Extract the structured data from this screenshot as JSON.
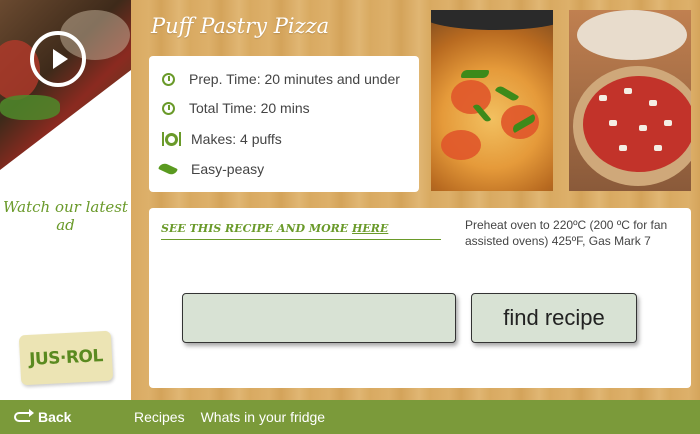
{
  "left_panel": {
    "watch_text": "Watch our latest ad",
    "logo_text": "JUS·ROL"
  },
  "recipe": {
    "title": "Puff Pastry Pizza",
    "info": [
      {
        "icon": "clock-icon",
        "label": "Prep. Time: 20 minutes and under"
      },
      {
        "icon": "timer-icon",
        "label": "Total Time: 20 mins"
      },
      {
        "icon": "plate-icon",
        "label": "Makes: 4 puffs"
      },
      {
        "icon": "rolling-pin-icon",
        "label": "Easy-peasy"
      }
    ],
    "see_link_prefix": "SEE THIS RECIPE AND MORE ",
    "see_link_here": "HERE",
    "preheat": "Preheat oven to 220ºC (200 ºC for fan assisted ovens) 425ºF, Gas Mark 7"
  },
  "search": {
    "value": "",
    "button_label": "find recipe"
  },
  "nav": {
    "back_label": "Back",
    "links": [
      "Recipes",
      "Whats in your fridge"
    ]
  },
  "colors": {
    "accent_green": "#6a9a2a",
    "nav_bar": "#7b9a3a",
    "button_bg": "#d8e2d4"
  }
}
